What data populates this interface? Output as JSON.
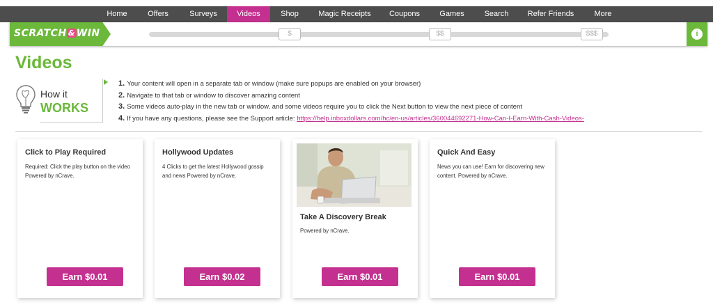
{
  "nav": {
    "items": [
      {
        "label": "Home",
        "active": false
      },
      {
        "label": "Offers",
        "active": false
      },
      {
        "label": "Surveys",
        "active": false
      },
      {
        "label": "Videos",
        "active": true
      },
      {
        "label": "Shop",
        "active": false
      },
      {
        "label": "Magic Receipts",
        "active": false
      },
      {
        "label": "Coupons",
        "active": false
      },
      {
        "label": "Games",
        "active": false
      },
      {
        "label": "Search",
        "active": false
      },
      {
        "label": "Refer Friends",
        "active": false
      },
      {
        "label": "More",
        "active": false
      }
    ]
  },
  "scratch_win": {
    "logo_text_1": "SCRATCH",
    "logo_amp": "&",
    "logo_text_2": "WIN",
    "milestones": [
      "$",
      "$$",
      "$$$"
    ],
    "info_label": "i"
  },
  "page_title": "Videos",
  "how_it_works": {
    "line1": "How it",
    "line2": "WORKS",
    "steps": [
      {
        "num": "1.",
        "text": "Your content will open in a separate tab or window (make sure popups are enabled on your browser)"
      },
      {
        "num": "2.",
        "text": "Navigate to that tab or window to discover amazing content"
      },
      {
        "num": "3.",
        "text": "Some videos auto-play in the new tab or window, and some videos require you to click the Next button to view the next piece of content"
      },
      {
        "num": "4.",
        "text": "If you have any questions, please see the Support article: ",
        "link": "https://help.inboxdollars.com/hc/en-us/articles/360044692271-How-Can-I-Earn-With-Cash-Videos-"
      }
    ]
  },
  "cards": [
    {
      "title": "Click to Play Required",
      "description": "Required: Click the play button on the video Powered by nCrave.",
      "button": "Earn $0.01",
      "has_image": false
    },
    {
      "title": "Hollywood Updates",
      "description": "4 Clicks to get the latest Hollywood gossip and news Powered by nCrave.",
      "button": "Earn $0.02",
      "has_image": false
    },
    {
      "title": "Take A Discovery Break",
      "description": "Powered by nCrave.",
      "button": "Earn $0.01",
      "has_image": true
    },
    {
      "title": "Quick And Easy",
      "description": "News you can use! Earn for discovering new content. Powered by nCrave.",
      "button": "Earn $0.01",
      "has_image": false
    }
  ],
  "colors": {
    "brand_green": "#6bb83a",
    "brand_magenta": "#c4308f",
    "nav_bg": "#4d4d4d"
  }
}
